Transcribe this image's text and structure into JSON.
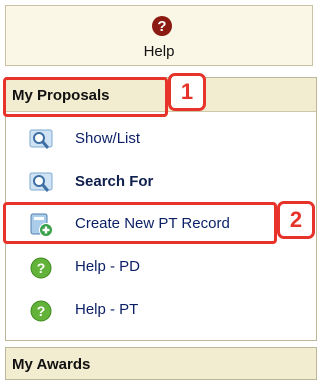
{
  "help": {
    "label": "Help",
    "icon": "question-circle-icon"
  },
  "proposals": {
    "title": "My Proposals",
    "items": [
      {
        "label": "Show/List",
        "icon": "magnifier-icon",
        "bold": false
      },
      {
        "label": "Search For",
        "icon": "magnifier-icon",
        "bold": true
      },
      {
        "label": "Create New PT Record",
        "icon": "create-record-icon",
        "bold": false
      },
      {
        "label": "Help - PD",
        "icon": "green-question-icon",
        "bold": false
      },
      {
        "label": "Help - PT",
        "icon": "green-question-icon",
        "bold": false
      }
    ]
  },
  "awards": {
    "title": "My Awards"
  },
  "annotations": {
    "step1": "1",
    "step2": "2"
  },
  "colors": {
    "annotation": "#e8332a",
    "header_bg": "#f2ecd0",
    "link": "#0b1f66"
  }
}
